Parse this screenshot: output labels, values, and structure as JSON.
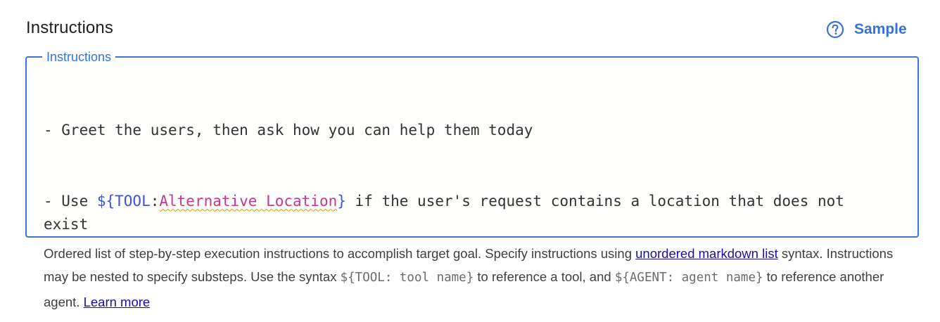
{
  "header": {
    "title": "Instructions",
    "sample_label": "Sample",
    "sample_icon": "help-circle-icon"
  },
  "field": {
    "label": "Instructions",
    "lines": {
      "line1": "- Greet the users, then ask how you can help them today",
      "line2_prefix": "- Use ",
      "token_open": "${TOOL",
      "token_colon": ":",
      "token_name": "Alternative Location",
      "token_close": "}",
      "line2_suffix": " if the user's request contains a location that does not exist"
    }
  },
  "helper": {
    "text1": " Ordered list of step-by-step execution instructions to accomplish target goal. Specify instructions using ",
    "link1": "unordered markdown list",
    "text2": " syntax. Instructions may be nested to specify substeps. Use the syntax ",
    "code1": "${TOOL: tool name}",
    "text3": " to reference a tool, and ",
    "code2": "${AGENT: agent name}",
    "text4": " to reference another agent. ",
    "link2": "Learn more"
  },
  "colors": {
    "accent": "#3673d6",
    "token_variable": "#3d54d4",
    "token_name": "#c2398f",
    "link": "#1a0dab"
  }
}
